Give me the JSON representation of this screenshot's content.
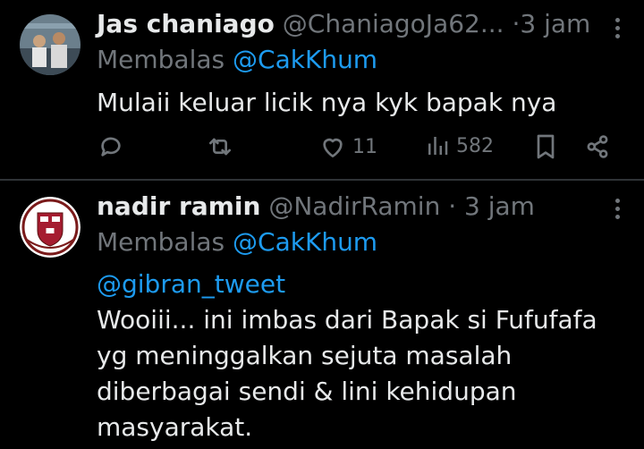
{
  "tweets": [
    {
      "display_name": "Jas chaniago",
      "handle": "@ChaniagoJa62...",
      "separator": "·",
      "time": "3 jam",
      "reply_prefix": "Membalas",
      "reply_to": "@CakKhum",
      "text": "Mulaii keluar licik nya kyk bapak nya",
      "likes": "11",
      "views": "582"
    },
    {
      "display_name": "nadir ramin",
      "handle": "@NadirRamin",
      "separator": "·",
      "time": "3 jam",
      "reply_prefix": "Membalas",
      "reply_to": "@CakKhum",
      "mention": "@gibran_tweet",
      "lines": [
        "Wooiii... ini imbas dari Bapak si Fufufafa",
        "yg meninggalkan sejuta masalah",
        "diberbagai sendi & lini kehidupan",
        "masyarakat."
      ]
    }
  ],
  "icons": [
    "reply-icon",
    "retweet-icon",
    "like-icon",
    "views-icon",
    "bookmark-icon",
    "share-icon",
    "more-icon"
  ],
  "colors": {
    "background": "#000000",
    "text": "#e7e9ea",
    "muted": "#71767b",
    "link": "#1d9bf0",
    "divider": "#2f3336"
  }
}
